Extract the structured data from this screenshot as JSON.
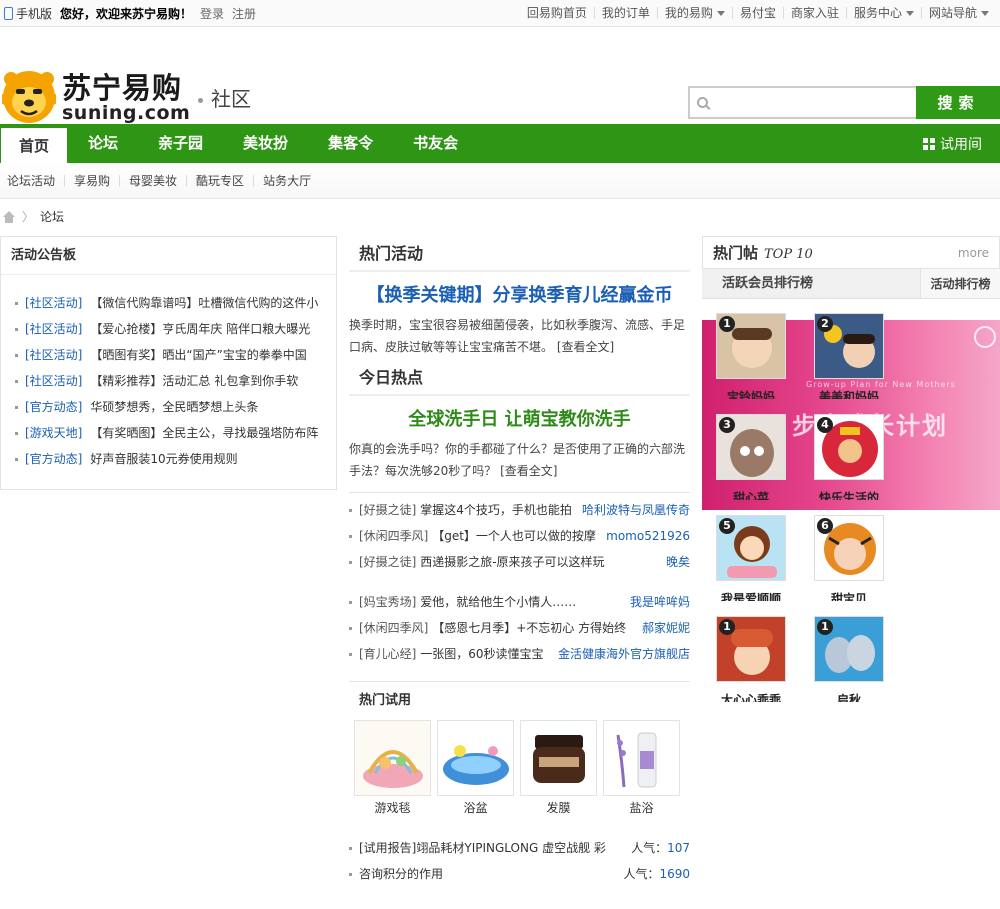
{
  "topbar": {
    "mobile": "手机版",
    "welcome": "您好，欢迎来苏宁易购！",
    "login": "登录",
    "register": "注册",
    "links": [
      "回易购首页",
      "我的订单",
      "我的易购",
      "易付宝",
      "商家入驻",
      "服务中心",
      "网站导航"
    ]
  },
  "header": {
    "brand_cn": "苏宁易购",
    "brand_en": "suning.com",
    "section": "社区",
    "search_button": "搜索",
    "search_placeholder": ""
  },
  "nav": {
    "items": [
      "首页",
      "论坛",
      "亲子园",
      "美妆扮",
      "集客令",
      "书友会"
    ],
    "trial": "试用间"
  },
  "subnav": [
    "论坛活动",
    "享易购",
    "母婴美妆",
    "酷玩专区",
    "站务大厅"
  ],
  "breadcrumb": "论坛",
  "board": {
    "title": "活动公告板",
    "items": [
      {
        "tag": "[社区活动]",
        "text": "【微信代购靠谱吗】吐槽微信代购的这件小"
      },
      {
        "tag": "[社区活动]",
        "text": "【爱心抢楼】亨氏周年庆 陪伴口粮大曝光"
      },
      {
        "tag": "[社区活动]",
        "text": "【晒图有奖】晒出“国产”宝宝的拳拳中国"
      },
      {
        "tag": "[社区活动]",
        "text": "【精彩推荐】活动汇总 礼包拿到你手软"
      },
      {
        "tag": "[官方动态]",
        "text": "华硕梦想秀，全民晒梦想上头条"
      },
      {
        "tag": "[游戏天地]",
        "text": "【有奖晒图】全民主公，寻找最强塔防布阵"
      },
      {
        "tag": "[官方动态]",
        "text": "好声音服装10元券使用规则"
      }
    ]
  },
  "hot_activity": {
    "title": "热门活动",
    "feature": "【换季关键期】分享换季育儿经赢金币",
    "desc": "换季时期，宝宝很容易被细菌侵袭，比如秋季腹泻、流感、手足口病、皮肤过敏等等让宝宝痛苦不堪。 [查看全文]"
  },
  "today_hot": {
    "title": "今日热点",
    "feature": "全球洗手日 让萌宝教你洗手",
    "desc": "你真的会洗手吗？你的手都碰了什么？是否使用了正确的六部洗手法？每次洗够20秒了吗？ [查看全文]"
  },
  "hot_list": [
    {
      "cat": "[好摄之徒]",
      "title": "掌握这4个技巧，手机也能拍",
      "user": "哈利波特与凤凰传奇"
    },
    {
      "cat": "[休闲四季风]",
      "title": "【get】一个人也可以做的按摩",
      "user": "momo521926"
    },
    {
      "cat": "[好摄之徒]",
      "title": "西递摄影之旅-原来孩子可以这样玩",
      "user": "晚矣"
    }
  ],
  "hot_list2": [
    {
      "cat": "[妈宝秀场]",
      "title": "爱他，就给他生个小情人……",
      "user": "我是哞哞妈"
    },
    {
      "cat": "[休闲四季风]",
      "title": "【感恩七月季】+不忘初心 方得始终",
      "user": "郝家妮妮"
    },
    {
      "cat": "[育儿心经]",
      "title": "一张图，60秒读懂宝宝",
      "user": "金活健康海外官方旗舰店"
    }
  ],
  "trial": {
    "title": "热门试用",
    "products": [
      "游戏毯",
      "浴盆",
      "发膜",
      "盐浴"
    ],
    "items": [
      {
        "title": "[试用报告]翊品耗材YIPINGLONG 虚空战舰 彩",
        "label": "人气：",
        "num": "107"
      },
      {
        "title": "咨询积分的作用",
        "label": "人气：",
        "num": "1690"
      }
    ]
  },
  "right": {
    "title": "热门帖",
    "top": "TOP 10",
    "more": "more",
    "tab1": "活跃会员排行榜",
    "tab2": "活动排行榜",
    "banner_text": "步步成长计划",
    "banner_sub": "Grow-up Plan for New Mothers",
    "members": [
      {
        "rank": "1",
        "name": "宝铃妈妈"
      },
      {
        "rank": "2",
        "name": "美美和妈妈"
      },
      {
        "rank": "3",
        "name": "甜心菜"
      },
      {
        "rank": "4",
        "name": "快乐生活的"
      },
      {
        "rank": "5",
        "name": "我是爱顺顺"
      },
      {
        "rank": "6",
        "name": "甜宝贝"
      },
      {
        "rank": "1",
        "name": "大心心乖乖"
      },
      {
        "rank": "1",
        "name": "启秋"
      }
    ]
  }
}
